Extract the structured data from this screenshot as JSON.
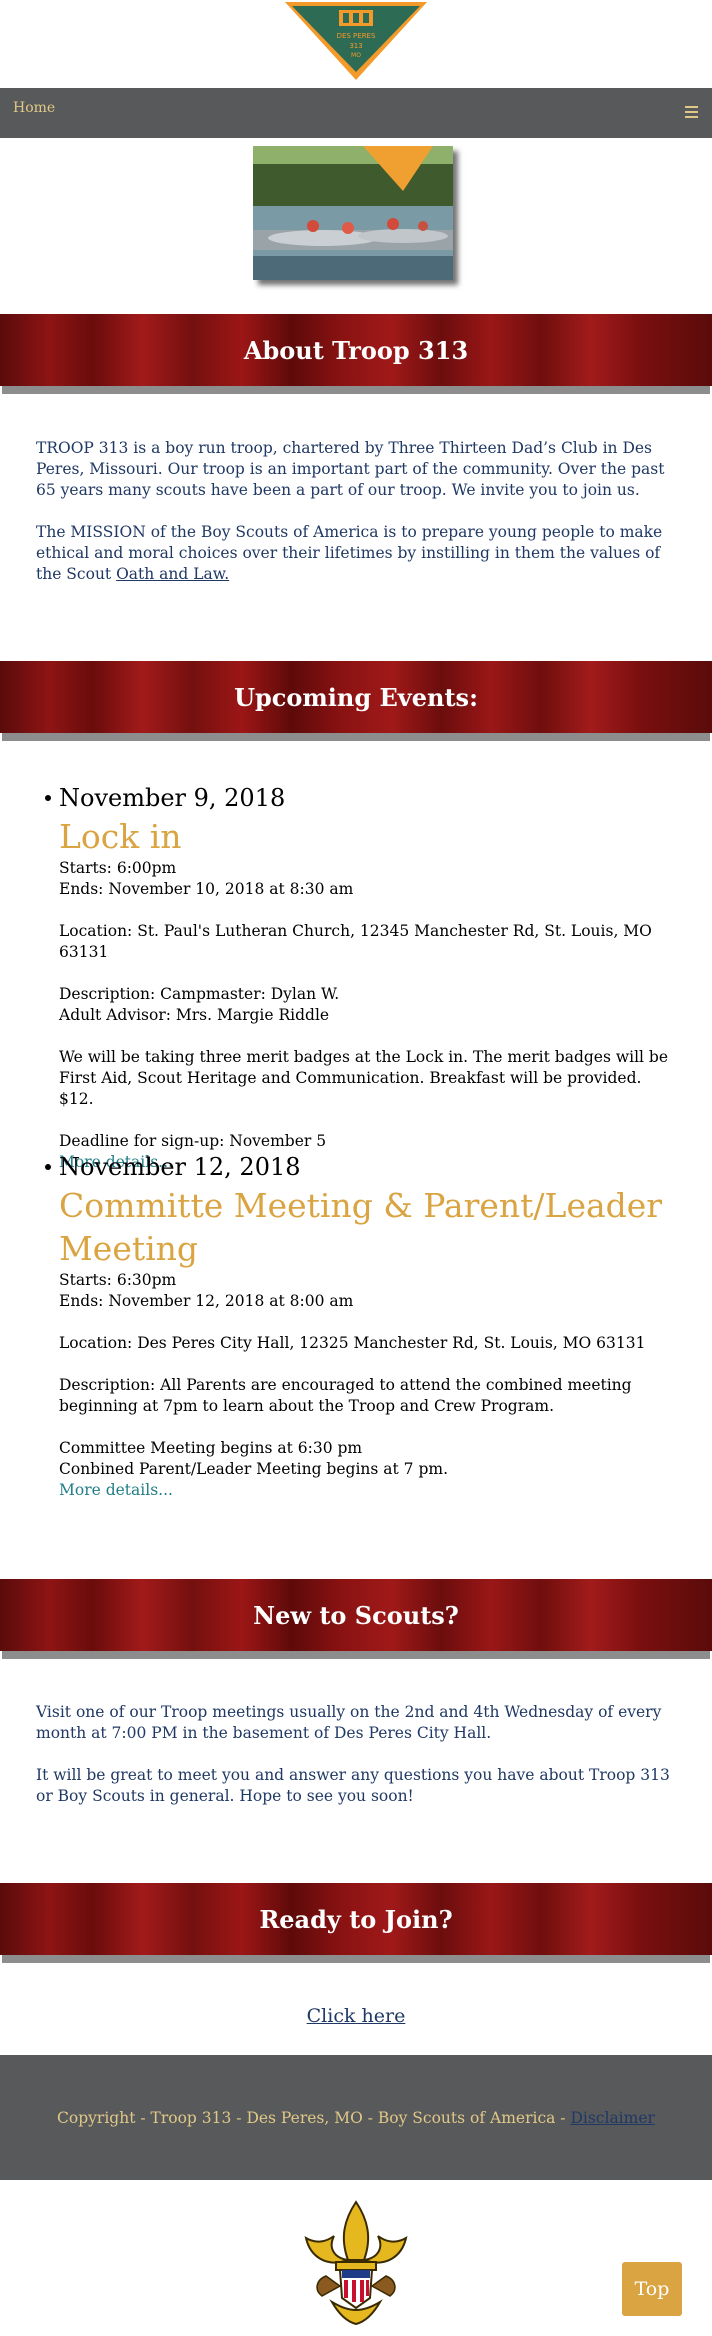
{
  "logo": {
    "text_line1": "DES PERES",
    "text_line2": "313",
    "text_line3": "MO"
  },
  "nav": {
    "home_label": "Home"
  },
  "sections": {
    "about": {
      "heading": "About Troop 313",
      "p1": "TROOP 313 is a boy run troop, chartered by Three Thirteen Dad’s Club in Des Peres, Missouri. Our troop is an important part of the community. Over the past 65 years many scouts have been a part of our troop. We invite you to join us.",
      "p2_text": "The MISSION of the Boy Scouts of America is to prepare young people to make ethical and moral choices over their lifetimes by instilling in them the values of the Scout",
      "p2_link": "Oath and Law."
    },
    "events": {
      "heading": "Upcoming Events:",
      "items": [
        {
          "date": "November 9, 2018",
          "title": "Lock in",
          "starts": "Starts: 6:00pm",
          "ends": "Ends: November 10, 2018 at 8:30 am",
          "location": "Location: St. Paul's Lutheran Church, 12345 Manchester Rd, St. Louis, MO 63131",
          "desc1": "Description: Campmaster: Dylan W.",
          "desc2": "Adult Advisor: Mrs. Margie Riddle",
          "body": "We will be taking three merit badges at the Lock in. The merit badges will be First Aid, Scout Heritage and Communication. Breakfast will be provided. $12.",
          "deadline": "Deadline for sign-up: November 5",
          "more": "More details..."
        },
        {
          "date": "November 12, 2018",
          "title": "Committe Meeting & Parent/Leader Meeting",
          "starts": "Starts: 6:30pm",
          "ends": "Ends: November 12, 2018 at 8:00 am",
          "location": "Location: Des Peres City Hall, 12325 Manchester Rd, St. Louis, MO 63131",
          "desc1": "Description: All Parents are encouraged to attend the combined meeting beginning at 7pm to learn about the Troop and Crew Program.",
          "line_a": "Committee Meeting begins at 6:30 pm",
          "line_b": "Conbined Parent/Leader Meeting begins at 7 pm.",
          "more": "More details..."
        }
      ]
    },
    "new_scouts": {
      "heading": "New to Scouts?",
      "p1": "Visit one of our Troop meetings usually on the 2nd and 4th Wednesday of every month at 7:00 PM in the basement of Des Peres City Hall.",
      "p2": "It will be great to meet you and answer any questions you have about Troop 313 or Boy Scouts in general. Hope to see you soon!"
    },
    "join": {
      "heading": "Ready to Join?",
      "link": "Click here"
    }
  },
  "footer": {
    "text": "Copyright - Troop 313 - Des Peres, MO - Boy Scouts of America - ",
    "link": "Disclaimer"
  },
  "top_button": "Top",
  "colors": {
    "banner_red": "#8e1414",
    "nav_gray": "#58595b",
    "gold": "#d9a441",
    "navy_text": "#1f3864",
    "teal_link": "#1f7d86"
  }
}
